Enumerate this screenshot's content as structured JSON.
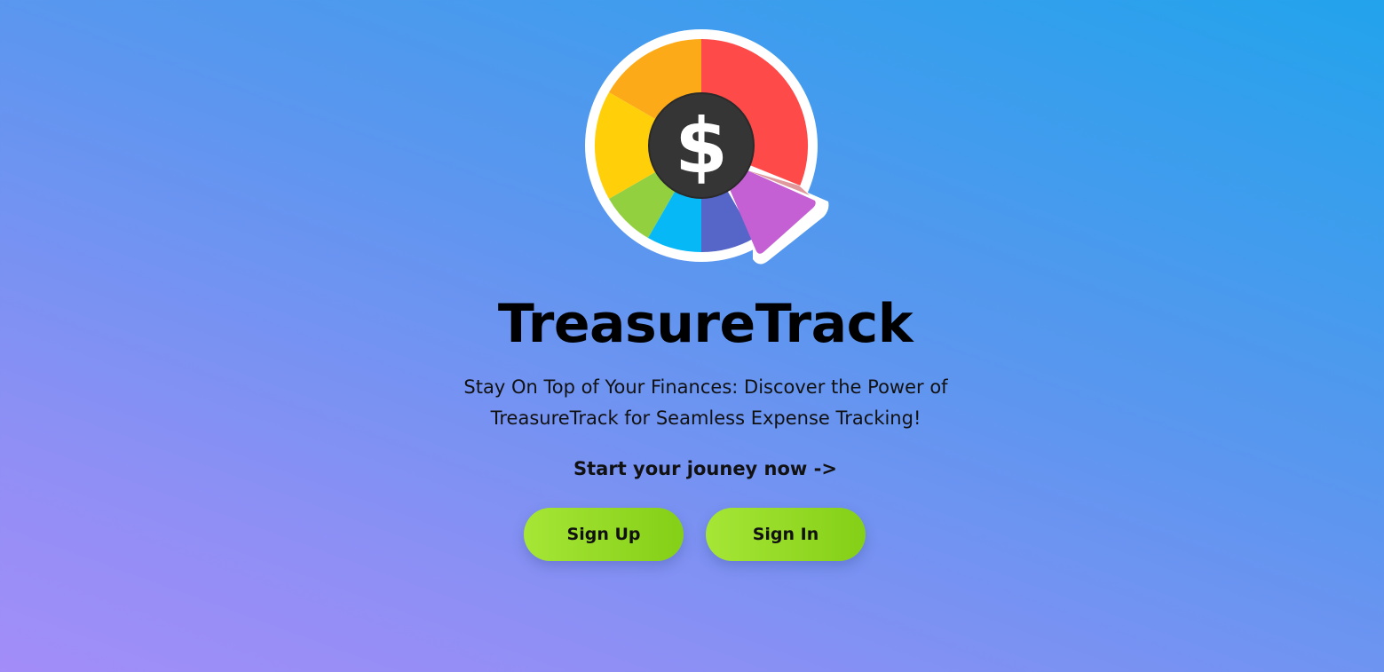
{
  "app": {
    "name": "TreasureTrack",
    "tagline": "Stay On Top of Your Finances: Discover the Power of TreasureTrack for Seamless Expense Tracking!",
    "cta": "Start your jouney now ->"
  },
  "buttons": {
    "sign_up": "Sign Up",
    "sign_in": "Sign In"
  },
  "logo": {
    "icon": "dollar-pie-chart-icon",
    "symbol": "$"
  },
  "colors": {
    "background_top_right": "#22a3ec",
    "background_bottom_left": "#a38df8",
    "button_start": "#a6e636",
    "button_end": "#84cf17"
  }
}
